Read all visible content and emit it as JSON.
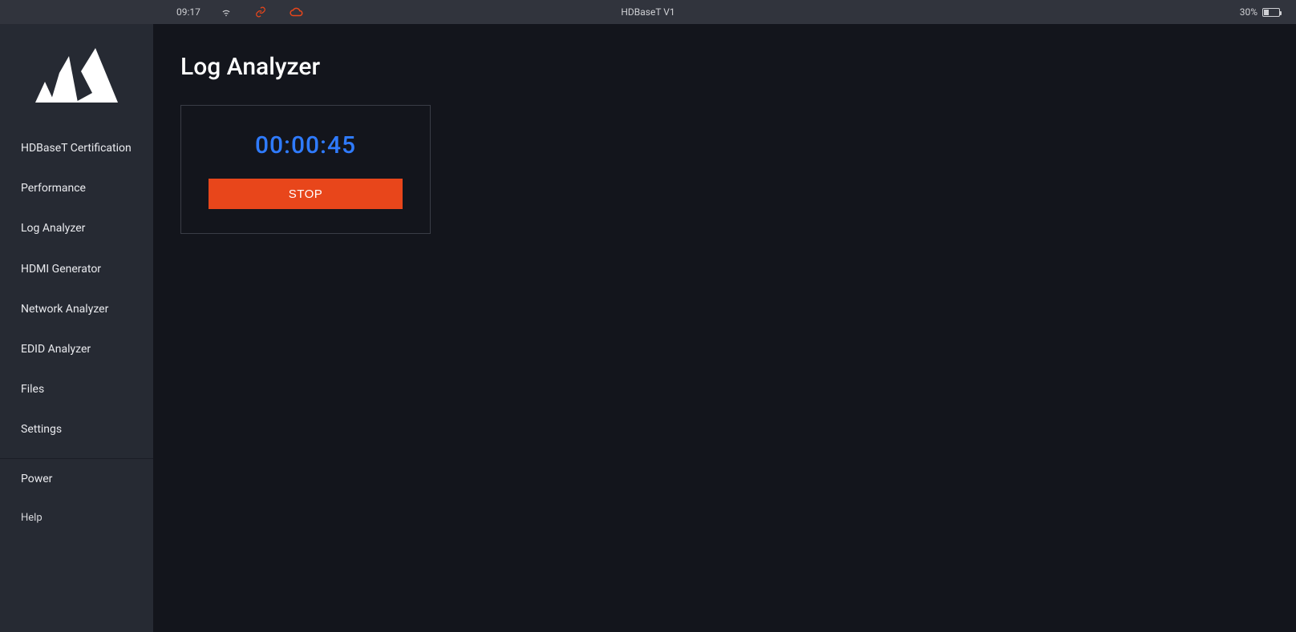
{
  "statusbar": {
    "time": "09:17",
    "title": "HDBaseT V1",
    "battery_pct": "30%"
  },
  "sidebar": {
    "items": [
      {
        "label": "HDBaseT Certification"
      },
      {
        "label": "Performance"
      },
      {
        "label": "Log Analyzer"
      },
      {
        "label": "HDMI Generator"
      },
      {
        "label": "Network Analyzer"
      },
      {
        "label": "EDID Analyzer"
      },
      {
        "label": "Files"
      },
      {
        "label": "Settings"
      }
    ],
    "secondary": [
      {
        "label": "Power"
      },
      {
        "label": "Help"
      }
    ]
  },
  "page": {
    "title": "Log Analyzer",
    "timer": "00:00:45",
    "stop_label": "STOP"
  },
  "colors": {
    "accent_blue": "#2f7bff",
    "danger_orange": "#e8461b"
  }
}
